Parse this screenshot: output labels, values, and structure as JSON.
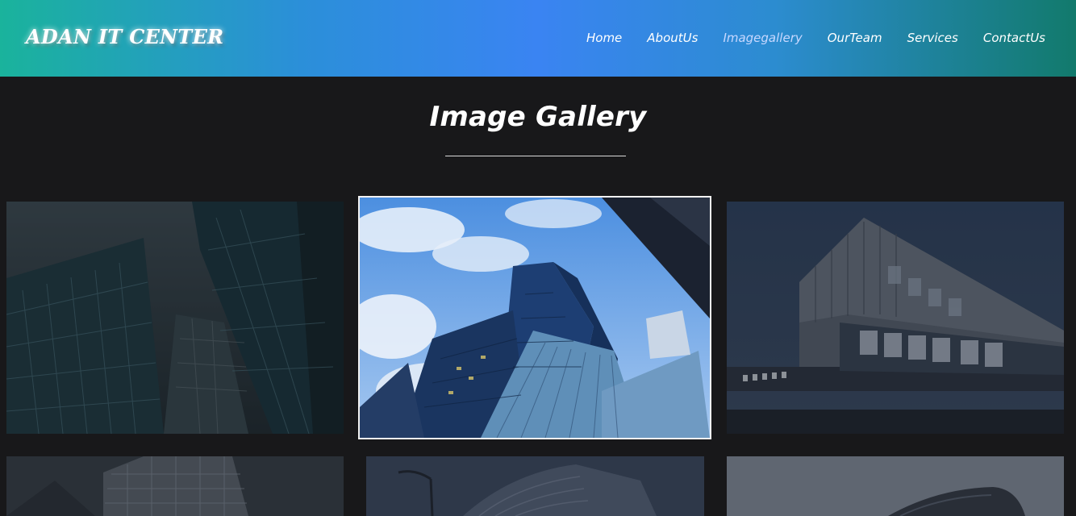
{
  "header": {
    "brand": "ADAN IT CENTER",
    "nav": [
      {
        "label": "Home",
        "active": false
      },
      {
        "label": "AboutUs",
        "active": false
      },
      {
        "label": "Imagegallery",
        "active": true
      },
      {
        "label": "OurTeam",
        "active": false
      },
      {
        "label": "Services",
        "active": false
      },
      {
        "label": "ContactUs",
        "active": false
      }
    ]
  },
  "main": {
    "title": "Image Gallery"
  },
  "gallery": {
    "images": [
      {
        "subject": "glass skyscrapers looking up",
        "highlighted": false
      },
      {
        "subject": "glass office tower against blue sky",
        "highlighted": true
      },
      {
        "subject": "modern office building at dusk",
        "highlighted": false
      },
      {
        "subject": "tower facade",
        "highlighted": false
      },
      {
        "subject": "curved building with street lamp",
        "highlighted": false
      },
      {
        "subject": "curved roof building",
        "highlighted": false
      }
    ]
  },
  "colors": {
    "header_gradient_start": "#1ab39c",
    "header_gradient_mid": "#3a84f2",
    "header_gradient_end": "#127a6c",
    "page_background": "#18181a",
    "active_nav": "#c8d8ff",
    "text": "#ffffff"
  }
}
